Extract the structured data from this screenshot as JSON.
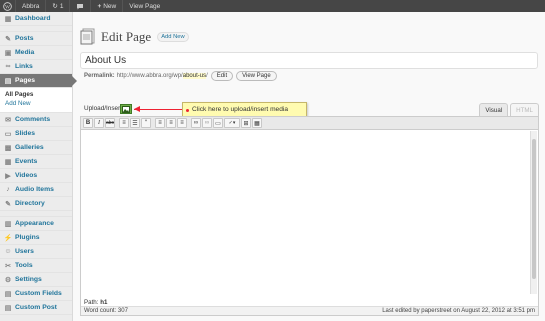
{
  "adminbar": {
    "site_name": "Abbra",
    "updates_count": "1",
    "new_label": "New",
    "view_page_label": "View Page"
  },
  "sidebar": {
    "items": [
      {
        "label": "Dashboard",
        "icon": "dashboard-icon"
      },
      {
        "label": "Posts",
        "icon": "pin-icon"
      },
      {
        "label": "Media",
        "icon": "media-icon"
      },
      {
        "label": "Links",
        "icon": "link-icon"
      },
      {
        "label": "Pages",
        "icon": "pages-icon"
      },
      {
        "label": "Comments",
        "icon": "comments-icon"
      },
      {
        "label": "Slides",
        "icon": "slides-icon"
      },
      {
        "label": "Galleries",
        "icon": "galleries-icon"
      },
      {
        "label": "Events",
        "icon": "events-icon"
      },
      {
        "label": "Videos",
        "icon": "videos-icon"
      },
      {
        "label": "Audio Items",
        "icon": "audio-icon"
      },
      {
        "label": "Directory",
        "icon": "directory-icon"
      },
      {
        "label": "Appearance",
        "icon": "appearance-icon"
      },
      {
        "label": "Plugins",
        "icon": "plugins-icon"
      },
      {
        "label": "Users",
        "icon": "users-icon"
      },
      {
        "label": "Tools",
        "icon": "tools-icon"
      },
      {
        "label": "Settings",
        "icon": "settings-icon"
      },
      {
        "label": "Custom Fields",
        "icon": "custom-fields-icon"
      },
      {
        "label": "Custom Post",
        "icon": "custom-post-icon"
      }
    ],
    "pages_submenu": [
      "All Pages",
      "Add New"
    ]
  },
  "main": {
    "page_title": "Edit Page",
    "add_new_label": "Add New",
    "title_value": "About Us",
    "permalink_label": "Permalink:",
    "permalink_base": "http://www.abbra.org/wp/",
    "permalink_slug": "about-us",
    "permalink_trailing": "/",
    "edit_button": "Edit",
    "view_page_button": "View Page",
    "upload_insert_label": "Upload/Insert",
    "callout_text": "Click here to upload/insert media",
    "tab_visual": "Visual",
    "tab_html": "HTML",
    "path_label": "Path:",
    "path_value": "h1",
    "word_count": "Word count: 307",
    "last_edited": "Last edited by paperstreet on August 22, 2012 at 3:51 pm"
  },
  "colors": {
    "adminbar_bg": "#464646",
    "link_blue": "#21759b",
    "current_menu_bg": "#777777",
    "callout_bg": "#fffbb0",
    "arrow_red": "#ee2233",
    "media_button_green": "#6fae49"
  },
  "toolbar_icons": [
    "bold-icon",
    "italic-icon",
    "strikethrough-icon",
    "bullet-list-icon",
    "numbered-list-icon",
    "blockquote-icon",
    "align-left-icon",
    "align-center-icon",
    "align-right-icon",
    "link-icon",
    "unlink-icon",
    "more-tag-icon",
    "spellcheck-icon",
    "fullscreen-icon",
    "kitchen-sink-icon"
  ]
}
